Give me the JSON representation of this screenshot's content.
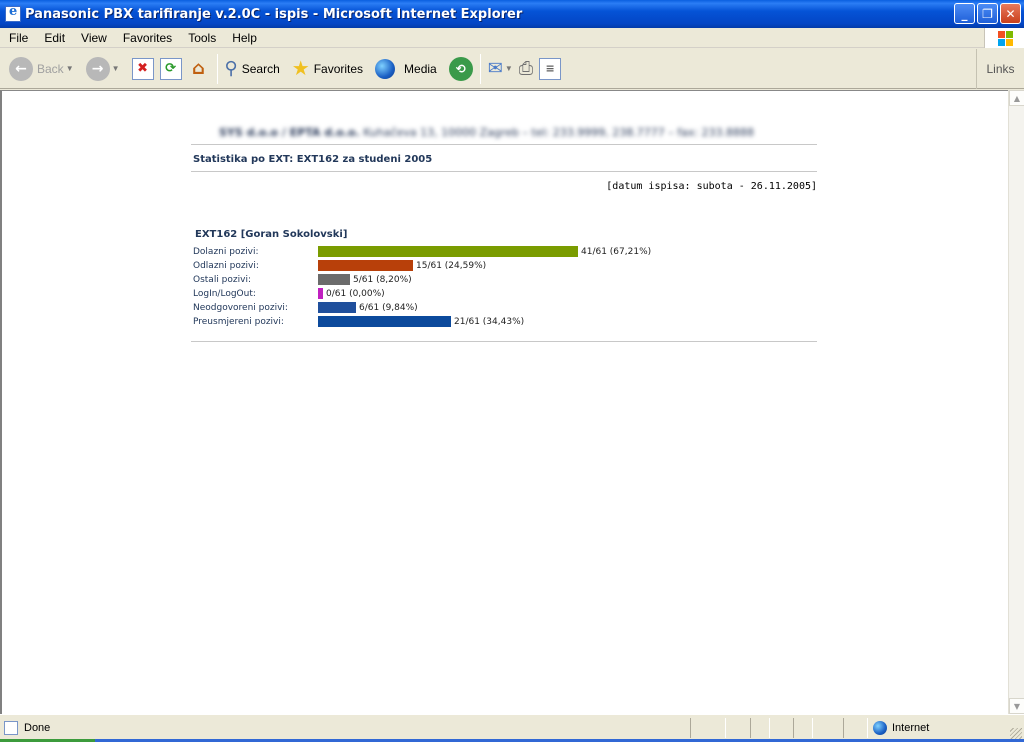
{
  "window": {
    "title": "Panasonic PBX tarifiranje v.2.0C - ispis - Microsoft Internet Explorer",
    "buttons": {
      "minimize": "_",
      "maximize": "❐",
      "close": "✕"
    }
  },
  "menu": [
    "File",
    "Edit",
    "View",
    "Favorites",
    "Tools",
    "Help"
  ],
  "toolbar": {
    "back": "Back",
    "search": "Search",
    "favorites": "Favorites",
    "media": "Media",
    "links": "Links"
  },
  "page": {
    "company_line_bold": "SYS d.o.o / EPTA d.o.o.",
    "company_line_rest": " Kuhačeva 13, 10000 Zagreb – tel: 233.9999, 238.7777 – fax: 233.8888",
    "report_title": "Statistika po EXT: EXT162 za studeni 2005",
    "print_date": "[datum ispisa: subota - 26.11.2005]",
    "ext_title": "EXT162 [Goran Sokolovski]",
    "stats": [
      {
        "label": "Dolazni pozivi:",
        "value": "41/61 (67,21%)",
        "fraction": 0.6721,
        "color": "#7a9c00"
      },
      {
        "label": "Odlazni pozivi:",
        "value": "15/61 (24,59%)",
        "fraction": 0.2459,
        "color": "#b8400a"
      },
      {
        "label": "Ostali pozivi:",
        "value": "5/61 (8,20%)",
        "fraction": 0.082,
        "color": "#6b6b6b"
      },
      {
        "label": "LogIn/LogOut:",
        "value": "0/61 (0,00%)",
        "fraction": 0.0,
        "color": "#c020c0"
      },
      {
        "label": "Neodgovoreni pozivi:",
        "value": "6/61 (9,84%)",
        "fraction": 0.0984,
        "color": "#1f4f9c"
      },
      {
        "label": "Preusmjereni pozivi:",
        "value": "21/61 (34,43%)",
        "fraction": 0.3443,
        "color": "#0c4a9c"
      }
    ]
  },
  "status": {
    "text": "Done",
    "zone": "Internet"
  }
}
